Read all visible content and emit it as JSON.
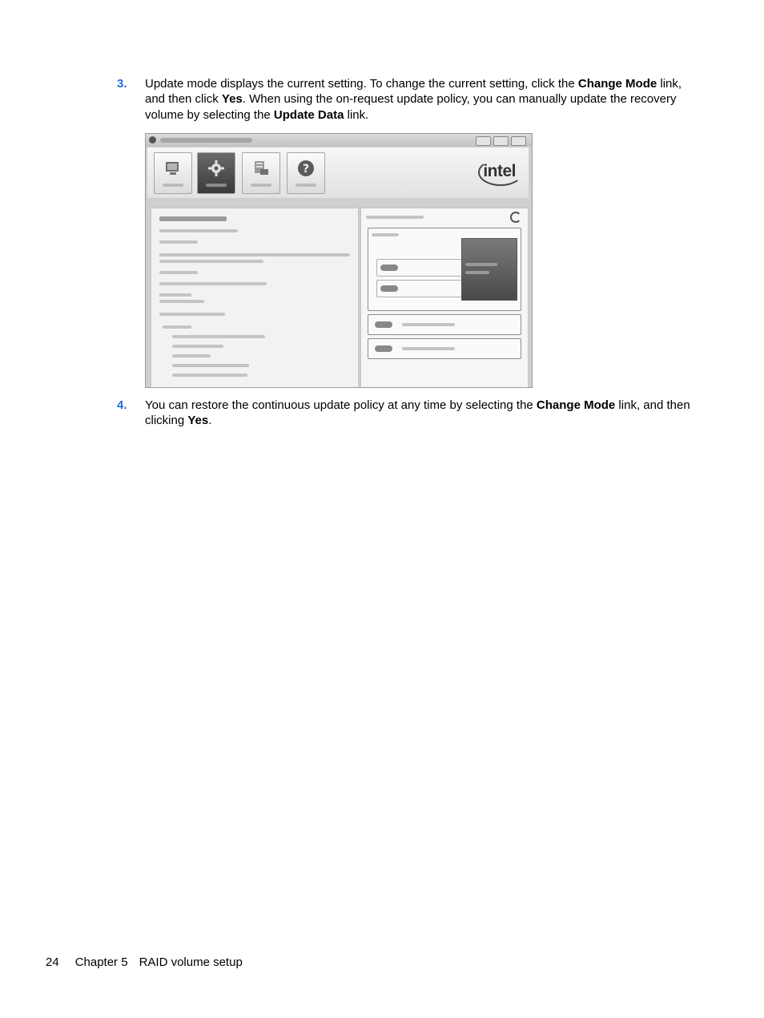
{
  "steps": [
    {
      "number": "3.",
      "parts": [
        {
          "t": "Update mode displays the current setting. To change the current setting, click the ",
          "b": false
        },
        {
          "t": "Change Mode",
          "b": true
        },
        {
          "t": " link, and then click ",
          "b": false
        },
        {
          "t": "Yes",
          "b": true
        },
        {
          "t": ". When using the on-request update policy, you can manually update the recovery volume by selecting the ",
          "b": false
        },
        {
          "t": "Update Data",
          "b": true
        },
        {
          "t": " link.",
          "b": false
        }
      ]
    },
    {
      "number": "4.",
      "parts": [
        {
          "t": "You can restore the continuous update policy at any time by selecting the ",
          "b": false
        },
        {
          "t": "Change Mode",
          "b": true
        },
        {
          "t": " link, and then clicking ",
          "b": false
        },
        {
          "t": "Yes",
          "b": true
        },
        {
          "t": ".",
          "b": false
        }
      ]
    }
  ],
  "screenshot": {
    "logo_text": "intel",
    "toolbar_icons": [
      "status-icon",
      "manage-icon",
      "preferences-icon",
      "help-icon"
    ],
    "accent_active": "#4a4a4a"
  },
  "footer": {
    "page_number": "24",
    "chapter": "Chapter 5",
    "title": "RAID volume setup"
  },
  "colors": {
    "step_number": "#1f6fd1",
    "text": "#000000"
  }
}
